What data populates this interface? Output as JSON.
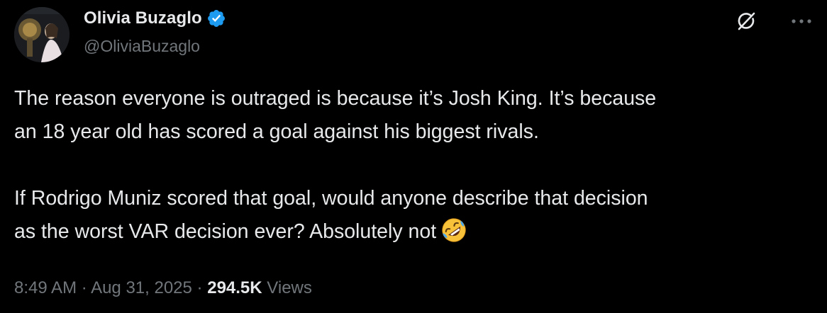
{
  "author": {
    "display_name": "Olivia Buzaglo",
    "handle": "@OliviaBuzaglo",
    "verified_icon": "verified-badge-icon",
    "verified_color": "#1d9bf0"
  },
  "actions": {
    "grok_icon": "grok-icon",
    "more_icon": "more-icon"
  },
  "tweet": {
    "line1": "The reason everyone is outraged is because it’s Josh King. It’s because",
    "line2": "an 18 year old has scored a goal against his biggest rivals.",
    "line3": "If Rodrigo Muniz scored that goal, would anyone describe that decision",
    "line4": "as the worst VAR decision ever? Absolutely not",
    "emoji_icon": "rolling-on-floor-laughing-emoji"
  },
  "meta": {
    "time": "8:49 AM",
    "separator": "·",
    "date": "Aug 31, 2025",
    "views_count": "294.5K",
    "views_label": "Views"
  },
  "colors": {
    "background": "#000000",
    "primary_text": "#e7e9ea",
    "secondary_text": "#71767b"
  }
}
